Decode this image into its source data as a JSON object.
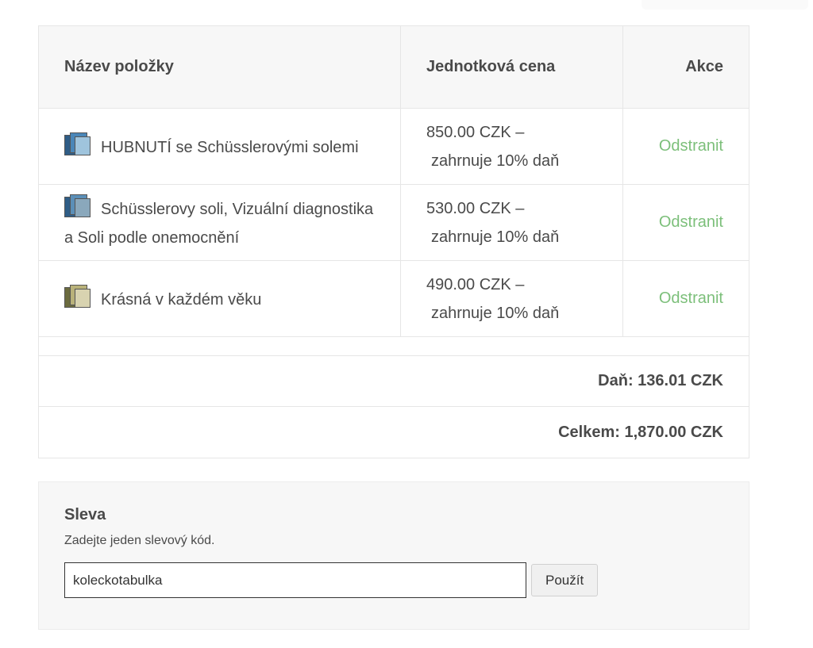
{
  "table": {
    "headers": {
      "name": "Název položky",
      "price": "Jednotková cena",
      "actions": "Akce"
    },
    "items": [
      {
        "name": "HUBNUTÍ se Schüsslerovými solemi",
        "price": "850.00 CZK –",
        "tax_note": "zahrnuje 10% daň",
        "remove_label": "Odstranit",
        "thumb_icon": "book-cover-thumbnail-icon"
      },
      {
        "name": "Schüsslerovy soli, Vizuální diagnostika a Soli podle onemocnění",
        "price": "530.00 CZK –",
        "tax_note": "zahrnuje 10% daň",
        "remove_label": "Odstranit",
        "thumb_icon": "book-cover-thumbnail-icon"
      },
      {
        "name": "Krásná v každém věku",
        "price": "490.00 CZK –",
        "tax_note": "zahrnuje 10% daň",
        "remove_label": "Odstranit",
        "thumb_icon": "book-cover-thumbnail-icon"
      }
    ],
    "tax_line": "Daň: 136.01 CZK",
    "total_line": "Celkem: 1,870.00 CZK"
  },
  "discount": {
    "title": "Sleva",
    "description": "Zadejte jeden slevový kód.",
    "code_value": "koleckotabulka",
    "apply_label": "Použít"
  },
  "colors": {
    "link": "#7cbf7a",
    "header_bg": "#f7f7f7",
    "border": "#e6e6e6"
  }
}
